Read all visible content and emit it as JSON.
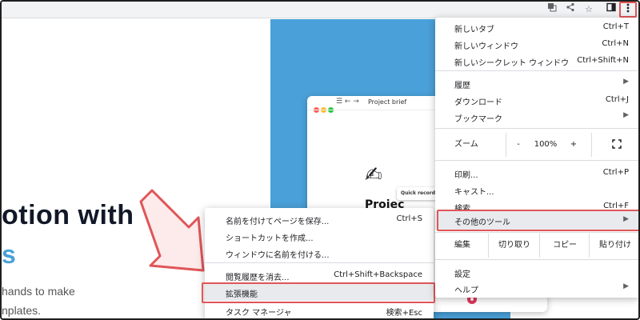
{
  "toolbar": {
    "icons": [
      "translate-icon",
      "share-icon",
      "star-icon",
      "side-panel-icon",
      "more-vert-icon"
    ]
  },
  "page": {
    "app_window_title": "Project brief",
    "app_heading": "Projec",
    "quick_recording": "Quick recording",
    "hero_line1": "otion with",
    "hero_line2": "s",
    "hero_sub1": "hands to make",
    "hero_sub2": "nplates."
  },
  "main_menu": {
    "new_tab": {
      "label": "新しいタブ",
      "shortcut": "Ctrl+T"
    },
    "new_window": {
      "label": "新しいウィンドウ",
      "shortcut": "Ctrl+N"
    },
    "new_incognito": {
      "label": "新しいシークレット ウィンドウ",
      "shortcut": "Ctrl+Shift+N"
    },
    "history": {
      "label": "履歴"
    },
    "downloads": {
      "label": "ダウンロード",
      "shortcut": "Ctrl+J"
    },
    "bookmarks": {
      "label": "ブックマーク"
    },
    "zoom": {
      "label": "ズーム",
      "minus": "-",
      "value": "100%",
      "plus": "+"
    },
    "print": {
      "label": "印刷...",
      "shortcut": "Ctrl+P"
    },
    "cast": {
      "label": "キャスト..."
    },
    "find": {
      "label": "検索...",
      "shortcut": "Ctrl+F"
    },
    "more_tools": {
      "label": "その他のツール"
    },
    "edit": {
      "label": "編集",
      "cut": "切り取り",
      "copy": "コピー",
      "paste": "貼り付け"
    },
    "settings": {
      "label": "設定"
    },
    "help": {
      "label": "ヘルプ"
    }
  },
  "sub_menu": {
    "save_page": {
      "label": "名前を付けてページを保存...",
      "shortcut": "Ctrl+S"
    },
    "create_shortcut": {
      "label": "ショートカットを作成..."
    },
    "name_window": {
      "label": "ウィンドウに名前を付ける..."
    },
    "clear_data": {
      "label": "閲覧履歴を消去...",
      "shortcut": "Ctrl+Shift+Backspace"
    },
    "extensions": {
      "label": "拡張機能"
    },
    "task_manager": {
      "label": "タスク マネージャ",
      "shortcut": "検索+Esc"
    }
  },
  "colors": {
    "highlight_box": "#e05558",
    "blue_panel": "#4aa0d8",
    "hero_accent": "#4aa0d8"
  }
}
